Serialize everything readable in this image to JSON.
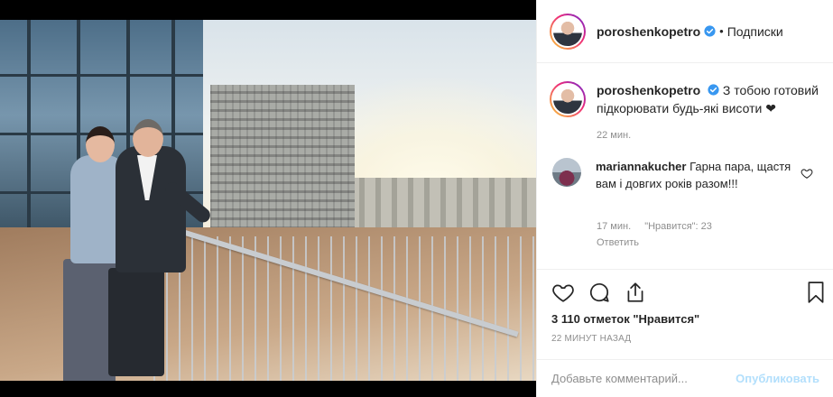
{
  "header": {
    "username": "poroshenkopetro",
    "separator": "•",
    "follow_label": "Подписки"
  },
  "caption": {
    "username": "poroshenkopetro",
    "text": "З тобою готовий підкорювати будь-які висоти ❤",
    "time": "22 мин."
  },
  "comments": [
    {
      "username": "mariannakucher",
      "text": "Гарна пара, щастя вам і довгих років разом!!!",
      "time": "17 мин.",
      "likes": "\"Нравится\": 23",
      "reply_label": "Ответить"
    }
  ],
  "actions": {
    "like_count": "3 110 отметок \"Нравится\"",
    "posted_ago": "22 МИНУТ НАЗАД"
  },
  "composer": {
    "placeholder": "Добавьте комментарий...",
    "post_label": "Опубликовать"
  },
  "colors": {
    "verified": "#3897f0",
    "link_disabled": "#b2dffc",
    "muted": "#8e8e8e"
  },
  "icons": [
    "verified-badge-icon",
    "heart-icon",
    "comment-icon",
    "share-icon",
    "bookmark-icon",
    "small-heart-icon"
  ]
}
